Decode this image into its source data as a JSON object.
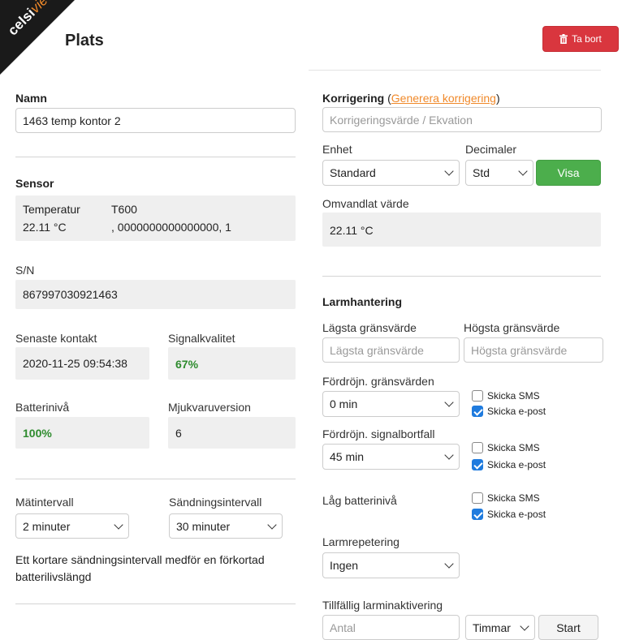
{
  "header": {
    "logo_main": "celsi",
    "logo_accent": "view",
    "title": "Plats",
    "delete_label": "Ta bort"
  },
  "left": {
    "name": {
      "label": "Namn",
      "value": "1463 temp kontor 2"
    },
    "sensor": {
      "label": "Sensor",
      "type": "Temperatur",
      "model": "T600",
      "reading": "22.11 °C",
      "details": ", 0000000000000000, 1"
    },
    "sn": {
      "label": "S/N",
      "value": "867997030921463"
    },
    "last_contact": {
      "label": "Senaste kontakt",
      "value": "2020-11-25 09:54:38"
    },
    "signal": {
      "label": "Signalkvalitet",
      "value": "67%"
    },
    "battery": {
      "label": "Batterinivå",
      "value": "100%"
    },
    "firmware": {
      "label": "Mjukvaruversion",
      "value": "6"
    },
    "measure_interval": {
      "label": "Mätintervall",
      "value": "2 minuter"
    },
    "send_interval": {
      "label": "Sändningsintervall",
      "value": "30 minuter"
    },
    "note": "Ett kortare sändningsintervall medför en förkortad batterilivslängd"
  },
  "right": {
    "correction": {
      "label": "Korrigering",
      "link_open": " (",
      "link": "Generera korrigering",
      "link_close": ")",
      "placeholder": "Korrigeringsvärde / Ekvation"
    },
    "unit": {
      "label": "Enhet",
      "value": "Standard"
    },
    "decimals": {
      "label": "Decimaler",
      "value": "Std"
    },
    "show_button": "Visa",
    "converted": {
      "label": "Omvandlat värde",
      "value": "22.11 °C"
    },
    "alarm": {
      "title": "Larmhantering",
      "low_label": "Lägsta gränsvärde",
      "low_placeholder": "Lägsta gränsvärde",
      "high_label": "Högsta gränsvärde",
      "high_placeholder": "Högsta gränsvärde",
      "delay_limits": {
        "label": "Fördröjn. gränsvärden",
        "value": "0 min"
      },
      "delay_signal": {
        "label": "Fördröjn. signalbortfall",
        "value": "45 min"
      },
      "low_battery_label": "Låg batterinivå",
      "sms_label": "Skicka SMS",
      "email_label": "Skicka e-post",
      "repeat": {
        "label": "Larmrepetering",
        "value": "Ingen"
      },
      "temp_activation": {
        "label": "Tillfällig larminaktivering",
        "count_placeholder": "Antal",
        "unit_value": "Timmar",
        "start_label": "Start"
      }
    }
  }
}
